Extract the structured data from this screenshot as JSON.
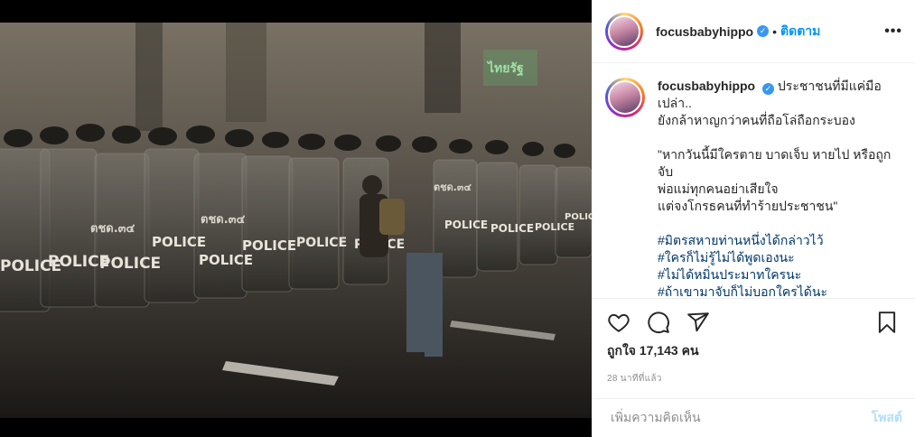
{
  "post": {
    "image_alt": "",
    "photo_labels": {
      "police": "POLICE",
      "unit_code": "ตชด.๓๔",
      "sign": "ไทยรัฐ"
    }
  },
  "header": {
    "username": "focusbabyhippo",
    "verified_icon": "verified-badge-icon",
    "separator": "•",
    "follow_label": "ติดตาม",
    "more_label": "•••"
  },
  "caption": {
    "username": "focusbabyhippo",
    "lines": [
      "ประชาชนที่มีแค่มือเปล่า..",
      "ยังกล้าหาญกว่าคนที่ถือโล่ถือกระบอง",
      "",
      "\"หากวันนี้มีใครตาย บาดเจ็บ หายไป หรือถูกจับ",
      "พ่อแม่ทุกคนอย่าเสียใจ",
      "แต่จงโกรธคนที่ทำร้ายประชาชน\"",
      ""
    ],
    "hashtags": [
      "#มิตรสหายท่านหนึ่งได้กล่าวไว้",
      "#ใครก็ไม่รู้ไม่ได้พูดเองนะ",
      "#ไม่ได้หมิ่นประมาทใครนะ",
      "#ถ้าเขามาจับก็ไม่บอกใครได้นะ"
    ]
  },
  "actions": {
    "like_icon": "heart-icon",
    "comment_icon": "comment-icon",
    "share_icon": "share-icon",
    "save_icon": "bookmark-icon",
    "likes_text": "ถูกใจ 17,143 คน",
    "time_text": "28 นาทีที่แล้ว"
  },
  "comment_box": {
    "placeholder": "เพิ่มความคิดเห็น",
    "post_label": "โพสต์"
  },
  "colors": {
    "link": "#0095f6",
    "hashtag": "#00376b",
    "verified": "#3897f0",
    "muted": "#8e8e8e"
  }
}
